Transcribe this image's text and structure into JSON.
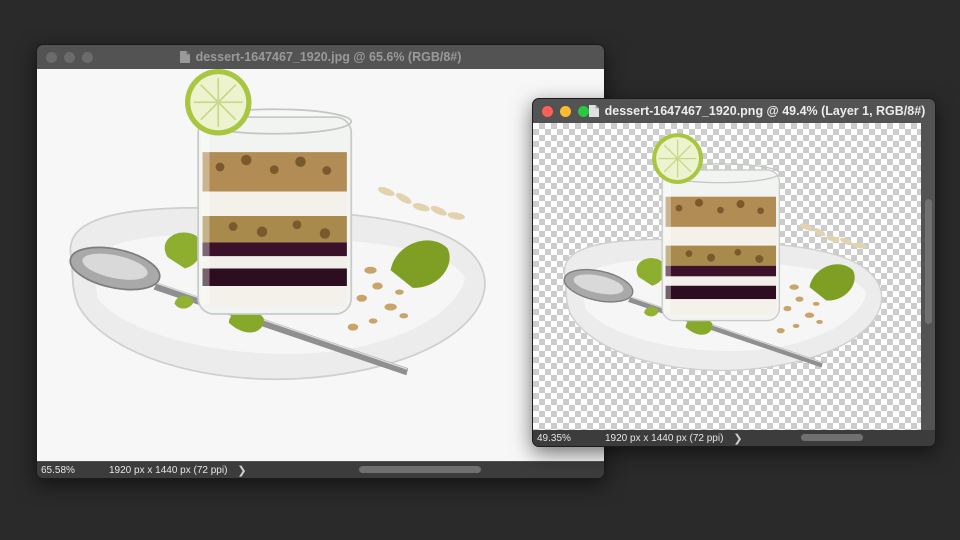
{
  "colors": {
    "desktop": "#2a2a2a",
    "window_chrome": "#535353",
    "inactive_title_text": "#9a9a9a",
    "active_title_text": "#ececec",
    "traffic_close": "#ff5f57",
    "traffic_minimize": "#febc2e",
    "traffic_zoom": "#28c840",
    "traffic_inactive": "#6b6b6b"
  },
  "windows": [
    {
      "state": "inactive",
      "icon": "document-icon",
      "title": "dessert-1647467_1920.jpg @ 65.6% (RGB/8#)",
      "status": {
        "zoom": "65.58%",
        "info": "1920 px x 1440 px (72 ppi)",
        "arrow": "❯"
      },
      "background": "white"
    },
    {
      "state": "active",
      "icon": "document-icon",
      "title": "dessert-1647467_1920.png @ 49.4% (Layer 1, RGB/8#)",
      "status": {
        "zoom": "49.35%",
        "info": "1920 px x 1440 px (72 ppi)",
        "arrow": "❯"
      },
      "background": "transparent-checkerboard"
    }
  ]
}
